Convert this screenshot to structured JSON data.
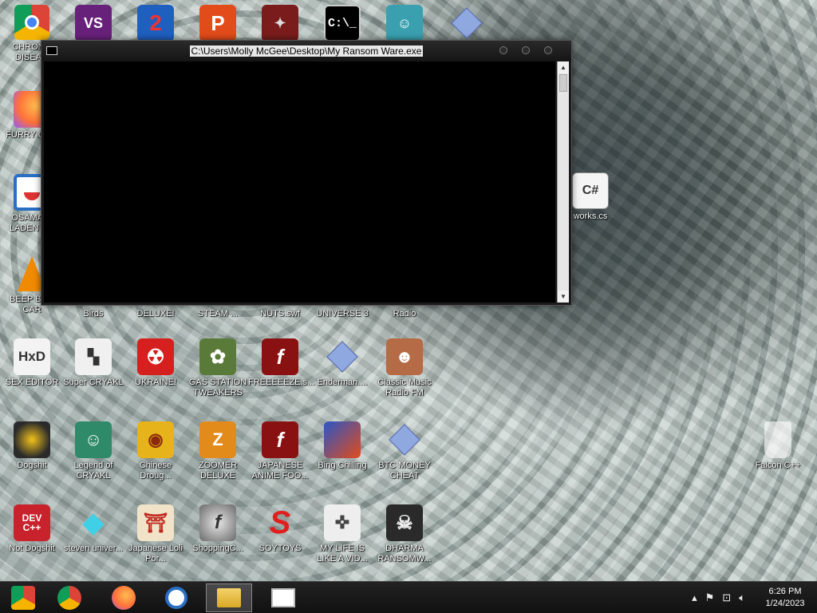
{
  "console_window": {
    "title": "C:\\Users\\Molly McGee\\Desktop\\My Ransom Ware.exe"
  },
  "desktop_icons": {
    "col1": [
      "CHRON... DISEA...",
      "FURRY CU...",
      "OSAMA ... LADEN E...",
      "BEEP BE... CAR",
      "SEX EDITOR",
      "Dogshit",
      "Not Dogshit"
    ],
    "row_hidden": [
      "Birds",
      "DELUXE!",
      "STEAM ...",
      "NUTS.swf",
      "UNIVERSE 3",
      "Radio"
    ],
    "row_middle": [
      "Super CRYAKL",
      "UKRAINE!",
      "GAS STATION TWEAKERS",
      "FREEEEEZE.s...",
      "Enderman....",
      "Classic Music Radio FM"
    ],
    "row_lower": [
      "Legend of CRYAKL",
      "Chinese Droug...",
      "ZOOMER DELUXE",
      "JAPANESE ANIME FOO...",
      "Bing Chilling",
      "BTC MONEY CHEAT"
    ],
    "row_bottom": [
      "steven univer...",
      "Japanese Loli Por...",
      "ShoppingC...",
      "SOYTOYS",
      "MY LIFE IS LIKE A VID...",
      "DHARMA RANSOMW..."
    ],
    "works": "works.cs",
    "falcon": "Falcon C++"
  },
  "taskbar": {
    "clock_time": "6:26 PM",
    "clock_date": "1/24/2023"
  },
  "colors": {
    "taskbar_bg": "#181818",
    "console_bg": "#000000"
  }
}
